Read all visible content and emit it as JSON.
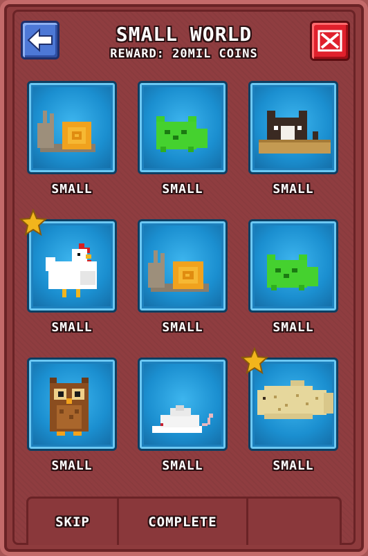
{
  "header": {
    "title": "SMALL WORLD",
    "subtitle": "REWARD: 20mil COINS"
  },
  "buttons": {
    "back_icon": "left-arrow-icon",
    "close_icon": "x-icon"
  },
  "grid": [
    {
      "animal": "snail",
      "label": "SMALL",
      "starred": false
    },
    {
      "animal": "green-cat",
      "label": "SMALL",
      "starred": false
    },
    {
      "animal": "cat-in-box",
      "label": "SMALL",
      "starred": false
    },
    {
      "animal": "chicken",
      "label": "SMALL",
      "starred": true
    },
    {
      "animal": "snail",
      "label": "SMALL",
      "starred": false
    },
    {
      "animal": "green-cat",
      "label": "SMALL",
      "starred": false
    },
    {
      "animal": "owl",
      "label": "SMALL",
      "starred": false
    },
    {
      "animal": "white-mouse",
      "label": "SMALL",
      "starred": false
    },
    {
      "animal": "fish",
      "label": "SMALL",
      "starred": true
    }
  ],
  "footer": {
    "skip_label": "SKIP",
    "complete_label": "COMPLETE"
  },
  "colors": {
    "frame": "#8e3b3d",
    "cell_blue": "#1b8fd0",
    "back_button": "#4d78d6",
    "close_button": "#e0202c",
    "star": "#f2b51c"
  }
}
